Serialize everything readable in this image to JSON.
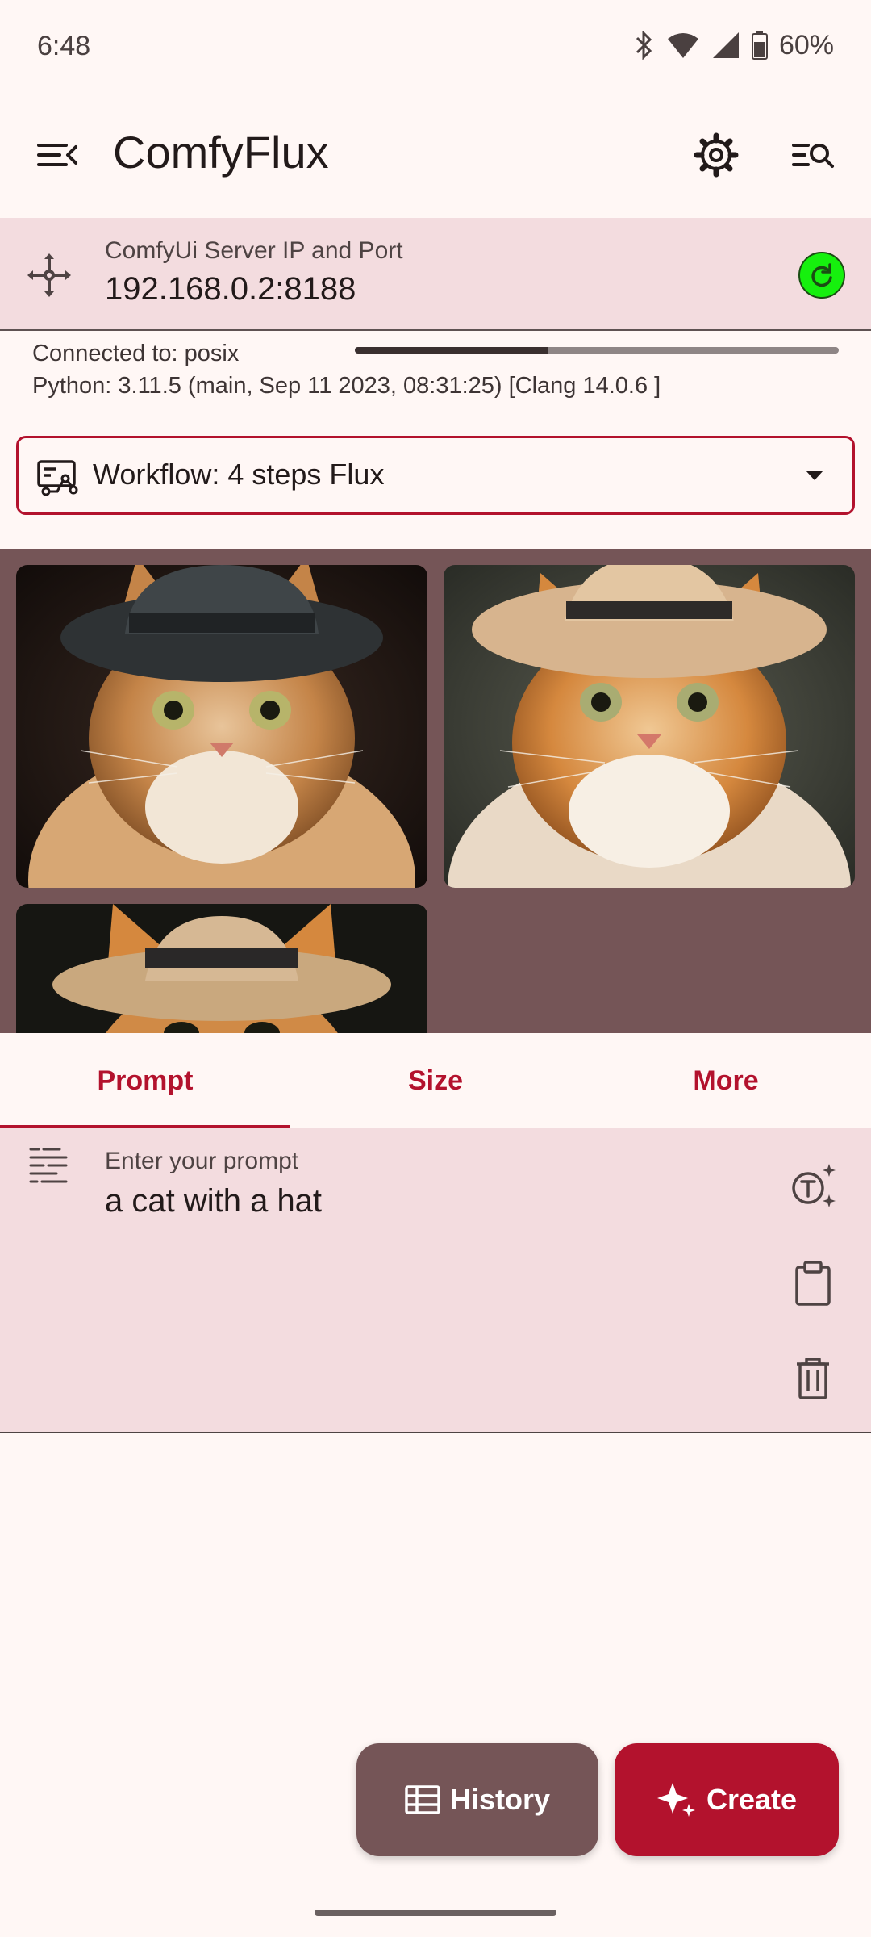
{
  "status_bar": {
    "time": "6:48",
    "battery": "60%",
    "icons": [
      "bluetooth-icon",
      "wifi-icon",
      "signal-icon",
      "battery-icon"
    ]
  },
  "app_bar": {
    "title": "ComfyFlux",
    "icons": [
      "menu-open-icon",
      "gear-icon",
      "search-list-icon"
    ]
  },
  "server": {
    "label": "ComfyUi Server IP and Port",
    "value": "192.168.0.2:8188",
    "status_color": "#16f00e"
  },
  "connection": {
    "connected_text": "Connected to: posix",
    "python_text": "Python: 3.11.5 (main, Sep 11 2023, 08:31:25) [Clang 14.0.6 ]",
    "progress_percent": 40
  },
  "workflow": {
    "label": "Workflow: 4 steps Flux"
  },
  "gallery": {
    "items": [
      {
        "description": "cat-dark-hat"
      },
      {
        "description": "cat-straw-hat"
      },
      {
        "description": "cat-straw-hat-partial"
      }
    ]
  },
  "tabs": [
    {
      "label": "Prompt",
      "active": true
    },
    {
      "label": "Size",
      "active": false
    },
    {
      "label": "More",
      "active": false
    }
  ],
  "prompt": {
    "label": "Enter your prompt",
    "value": "a cat with a hat"
  },
  "buttons": {
    "history": "History",
    "create": "Create"
  },
  "colors": {
    "primary": "#b3122d",
    "secondary": "#755557",
    "surface": "#fff7f5",
    "field": "#f3dcdf"
  }
}
